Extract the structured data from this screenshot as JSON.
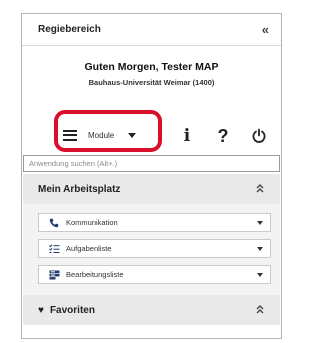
{
  "header": {
    "title": "Regiebereich",
    "collapse_label": "«"
  },
  "greeting": {
    "line1": "Guten Morgen, Tester MAP",
    "line2": "Bauhaus-Universität Weimar (1400)"
  },
  "toolbar": {
    "module_label": "Module",
    "info_label": "i",
    "help_label": "?"
  },
  "search": {
    "placeholder": "Anwendung suchen (Alt+.)",
    "value": ""
  },
  "sections": {
    "arbeitsplatz": {
      "title": "Mein Arbeitsplatz",
      "items": [
        {
          "label": "Kommunikation",
          "icon": "phone-icon"
        },
        {
          "label": "Aufgabenliste",
          "icon": "task-list-icon"
        },
        {
          "label": "Bearbeitungsliste",
          "icon": "edit-list-icon"
        }
      ]
    },
    "favoriten": {
      "title": "Favoriten",
      "icon": "heart-icon"
    }
  },
  "colors": {
    "highlight": "#d9102a",
    "section_bg": "#e9e9e9",
    "border": "#b3b3b3"
  }
}
